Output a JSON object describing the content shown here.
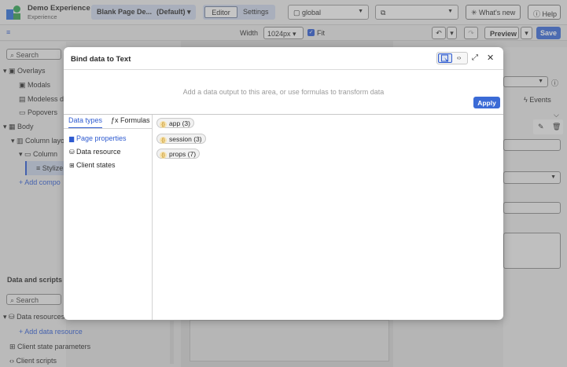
{
  "app": {
    "title": "Demo Experience",
    "subtitle": "Experience"
  },
  "topbar": {
    "page_name": "Blank Page De...",
    "page_variant": "(Default)",
    "mode_tabs": [
      "Editor",
      "Settings"
    ],
    "scope": "global",
    "whats_new": "What's new",
    "help": "Help"
  },
  "toolbar": {
    "width_label": "Width",
    "width_value": "1024px",
    "fit_label": "Fit",
    "preview": "Preview",
    "save": "Save"
  },
  "left_panel": {
    "search_placeholder": "Search",
    "tree": [
      {
        "label": "Overlays"
      },
      {
        "label": "Modals"
      },
      {
        "label": "Modeless d"
      },
      {
        "label": "Popovers"
      },
      {
        "label": "Body"
      },
      {
        "label": "Column layo"
      },
      {
        "label": "Column"
      },
      {
        "label": "Stylize"
      }
    ],
    "add_component": "+ Add compo",
    "data_section_title": "Data and scripts",
    "data_search_placeholder": "Search",
    "data_resources": "Data resources",
    "add_data_resource": "+ Add data resource",
    "client_state_params": "Client state parameters",
    "client_scripts": "Client scripts"
  },
  "right_panel": {
    "events_label": "Events"
  },
  "modal": {
    "title": "Bind data to Text",
    "formula_placeholder": "Add a data output to this area, or use formulas to transform data",
    "apply": "Apply",
    "tabs": [
      "Data types",
      "Formulas"
    ],
    "categories": [
      "Page properties",
      "Data resource",
      "Client states"
    ],
    "pills": [
      {
        "name": "app",
        "count": "(3)"
      },
      {
        "name": "session",
        "count": "(3)"
      },
      {
        "name": "props",
        "count": "(7)"
      }
    ]
  },
  "colors": {
    "accent": "#3b6bd6",
    "pill_icon_bg": "#f7e3ad"
  }
}
